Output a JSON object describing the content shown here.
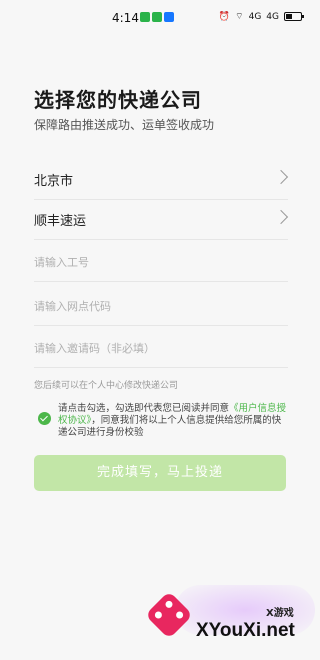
{
  "status_bar": {
    "time": "4:14",
    "app_icons": [
      {
        "name": "wechat-icon",
        "color": "#2bb34a"
      },
      {
        "name": "message-icon",
        "color": "#2bb34a"
      },
      {
        "name": "alipay-icon",
        "color": "#1677ff"
      }
    ],
    "right_icons": [
      "alarm-icon",
      "wifi-icon",
      "signal-1-icon",
      "signal-2-icon",
      "battery-icon"
    ],
    "signal_label_1": "4G",
    "signal_label_2": "4G"
  },
  "header": {
    "title": "选择您的快递公司",
    "subtitle": "保障路由推送成功、运单签收成功"
  },
  "form": {
    "city": "北京市",
    "company": "顺丰速运",
    "employee_id_placeholder": "请输入工号",
    "outlet_code_placeholder": "请输入网点代码",
    "invite_code_placeholder": "请输入邀请码（非必填）"
  },
  "hint": "您后续可以在个人中心修改快递公司",
  "agreement": {
    "text_before": "请点击勾选，勾选即代表您已阅读并同意",
    "link": "《用户信息授权协议》",
    "text_after": "，同意我们将以上个人信息提供给您所属的快递公司进行身份校验",
    "checked": true
  },
  "submit_label": "完成填写，马上投递",
  "watermark": {
    "small": "X游戏",
    "text": "XYouXi.net"
  },
  "colors": {
    "accent": "#4cb74a",
    "button_disabled": "#c2e6a7"
  }
}
